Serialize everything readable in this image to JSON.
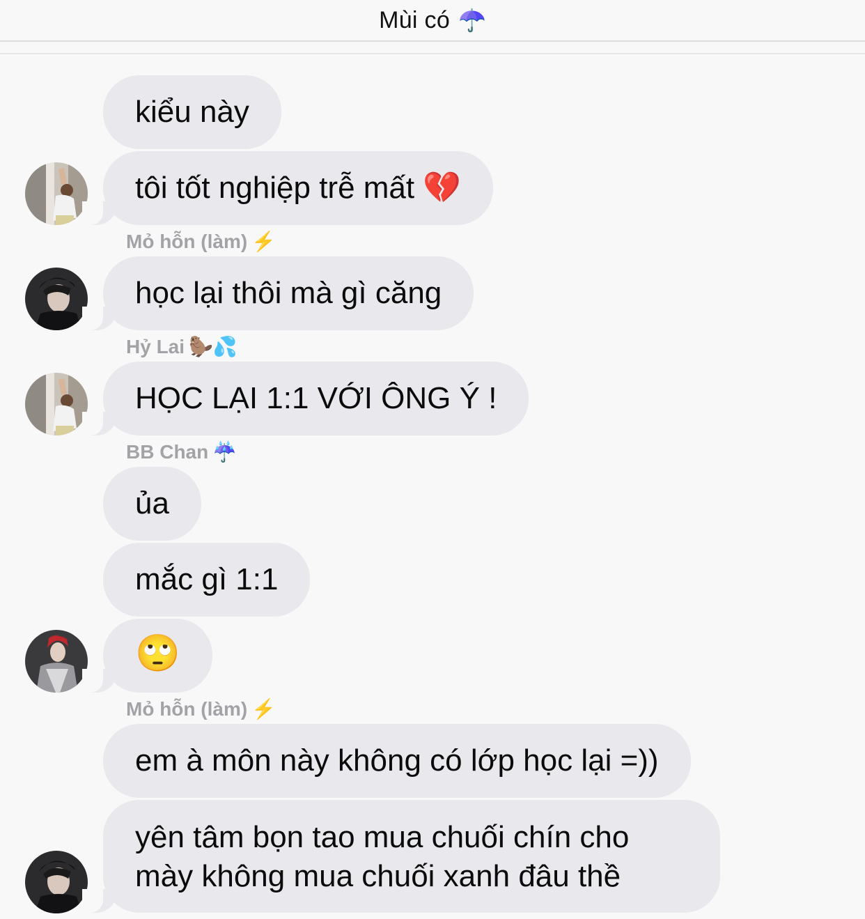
{
  "header": {
    "title": "Mùi có",
    "emoji": "☂️"
  },
  "messages": [
    {
      "text": "kiểu này"
    },
    {
      "text": "tôi tốt nghiệp trễ mất 💔"
    },
    {
      "sender": "Mỏ hỗn (làm)",
      "sender_emoji": "⚡️"
    },
    {
      "text": "học lại thôi mà gì căng"
    },
    {
      "sender": "Hỷ Lai",
      "sender_emoji": "🦫💦"
    },
    {
      "text": "HỌC LẠI 1:1 VỚI ÔNG Ý !"
    },
    {
      "sender": "BB Chan",
      "sender_emoji": "☔️"
    },
    {
      "text": "ủa"
    },
    {
      "text": "mắc gì 1:1"
    },
    {
      "text": "🙄"
    },
    {
      "sender": "Mỏ hỗn (làm)",
      "sender_emoji": "⚡️"
    },
    {
      "text": "em à môn này không có lớp học lại =))"
    },
    {
      "text": "yên tâm bọn tao mua chuối chín cho mày không mua chuối xanh đâu thề"
    }
  ]
}
